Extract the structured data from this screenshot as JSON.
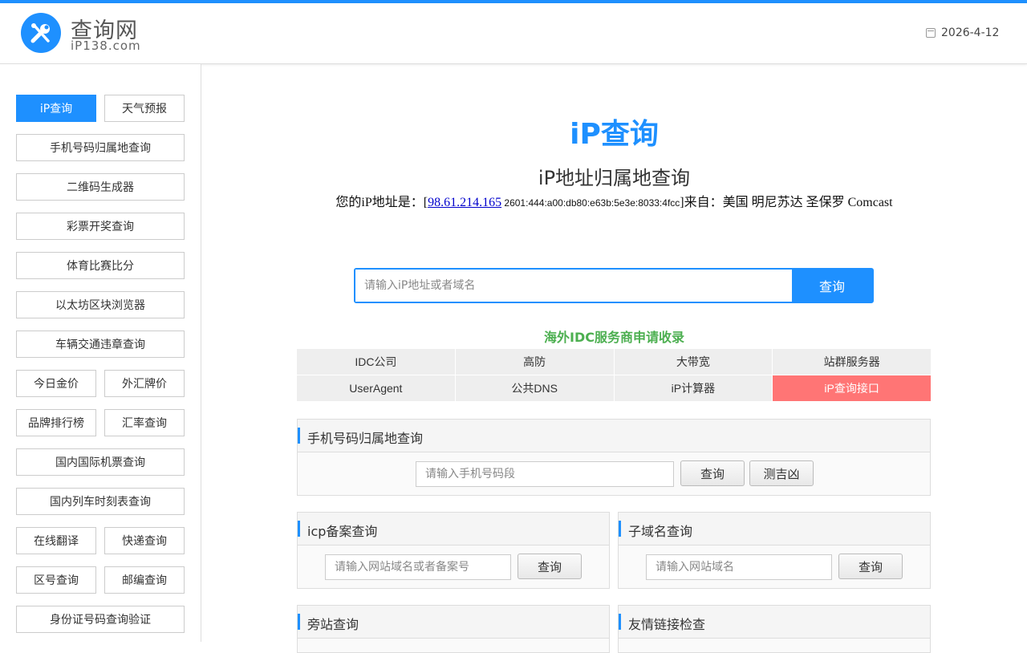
{
  "header": {
    "logo_title": "查询网",
    "logo_sub": "iP138.com",
    "date": "2026-4-12"
  },
  "sidebar": {
    "items": [
      "iP查询",
      "天气预报",
      "手机号码归属地查询",
      "二维码生成器",
      "彩票开奖查询",
      "体育比赛比分",
      "以太坊区块浏览器",
      "车辆交通违章查询",
      "今日金价",
      "外汇牌价",
      "品牌排行榜",
      "汇率查询",
      "国内国际机票查询",
      "国内列车时刻表查询",
      "在线翻译",
      "快递查询",
      "区号查询",
      "邮编查询",
      "身份证号码查询验证"
    ]
  },
  "main": {
    "brand": "iP查询",
    "title": "iP地址归属地查询",
    "ip_prefix": "您的iP地址是：[",
    "ip_v4": "98.61.214.165",
    "ip_v6": " 2601:444:a00:db80:e63b:5e3e:8033:4fcc",
    "ip_suffix": "]来自：美国 明尼苏达 圣保罗 Comcast",
    "search_placeholder": "请输入iP地址或者域名",
    "search_button": "查询",
    "idc_title": "海外IDC服务商申请收录",
    "grid": [
      "IDC公司",
      "高防",
      "大带宽",
      "站群服务器",
      "UserAgent",
      "公共DNS",
      "iP计算器",
      "iP查询接口"
    ]
  },
  "panels": {
    "mobile": {
      "title": "手机号码归属地查询",
      "placeholder": "请输入手机号码段",
      "btn1": "查询",
      "btn2": "测吉凶"
    },
    "icp": {
      "title": "icp备案查询",
      "placeholder": "请输入网站域名或者备案号",
      "btn": "查询"
    },
    "subdomain": {
      "title": "子域名查询",
      "placeholder": "请输入网站域名",
      "btn": "查询"
    },
    "sidesite": {
      "title": "旁站查询"
    },
    "friendlink": {
      "title": "友情链接检查"
    }
  },
  "colors": {
    "accent": "#1e90ff",
    "green": "#4caf50",
    "highlight": "#ff7575"
  },
  "icons": {
    "logo": "tools-icon",
    "date": "calendar-icon"
  }
}
